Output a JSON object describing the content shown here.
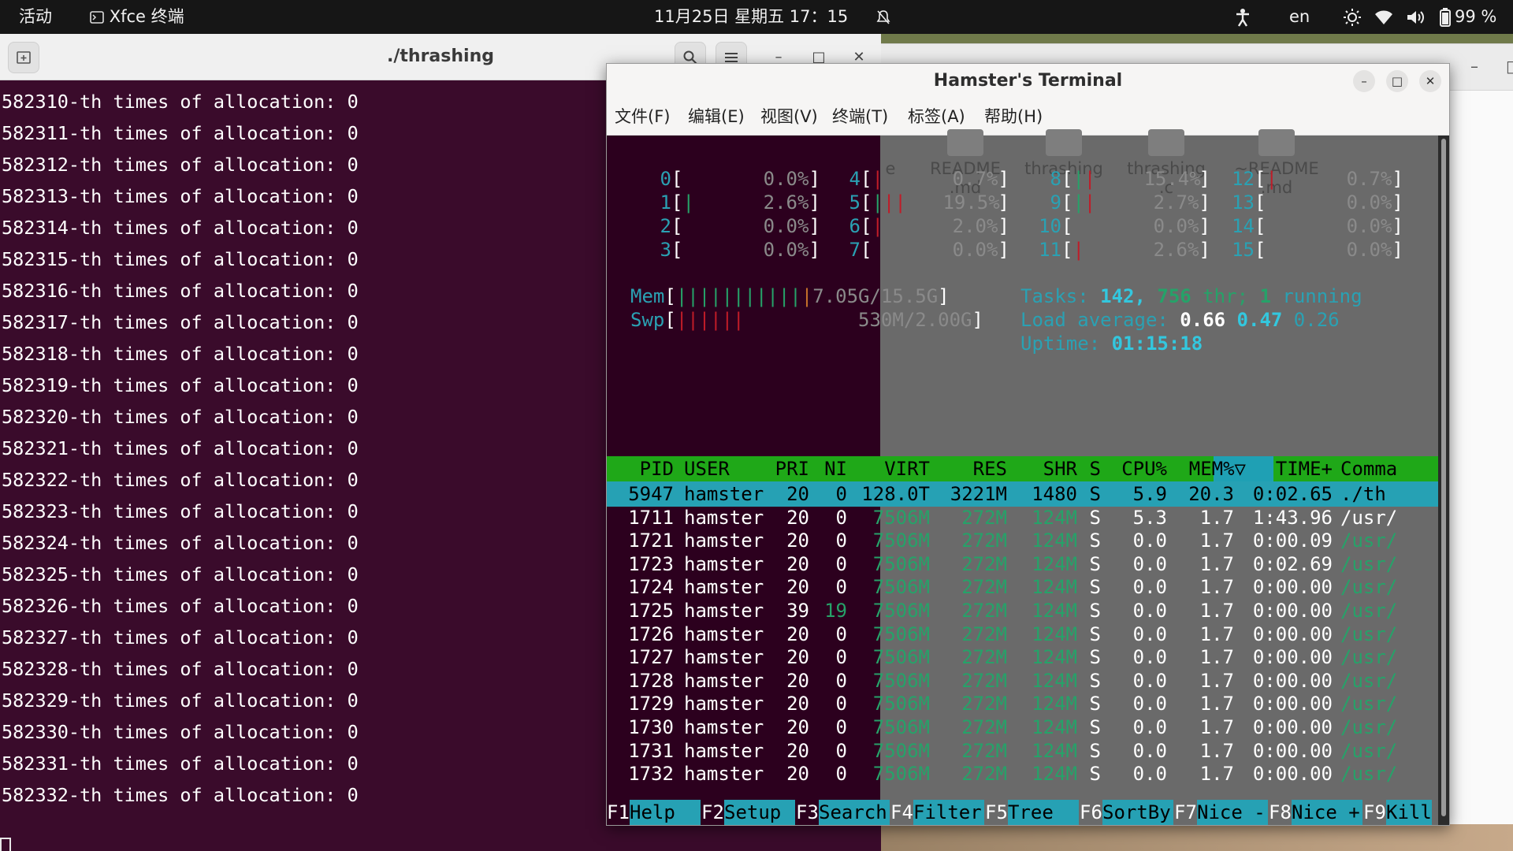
{
  "topbar": {
    "activities": "活动",
    "app_name": "Xfce 终端",
    "datetime": "11月25日 星期五 17：15",
    "lang": "en",
    "battery": "99 %"
  },
  "left_terminal": {
    "title": "./thrashing",
    "lines": [
      "582310-th times of allocation: 0",
      "582311-th times of allocation: 0",
      "582312-th times of allocation: 0",
      "582313-th times of allocation: 0",
      "582314-th times of allocation: 0",
      "582315-th times of allocation: 0",
      "582316-th times of allocation: 0",
      "582317-th times of allocation: 0",
      "582318-th times of allocation: 0",
      "582319-th times of allocation: 0",
      "582320-th times of allocation: 0",
      "582321-th times of allocation: 0",
      "582322-th times of allocation: 0",
      "582323-th times of allocation: 0",
      "582324-th times of allocation: 0",
      "582325-th times of allocation: 0",
      "582326-th times of allocation: 0",
      "582327-th times of allocation: 0",
      "582328-th times of allocation: 0",
      "582329-th times of allocation: 0",
      "582330-th times of allocation: 0",
      "582331-th times of allocation: 0",
      "582332-th times of allocation: 0"
    ]
  },
  "hamster": {
    "title": "Hamster's Terminal",
    "menu": [
      "文件(F)",
      "编辑(E)",
      "视图(V)",
      "终端(T)",
      "标签(A)",
      "帮助(H)"
    ],
    "desktop_icons": [
      "e",
      "README\n.md",
      "thrashing",
      "thrashing\n.c",
      "~README\n.md"
    ],
    "cpus": [
      {
        "id": "0",
        "pct": "0.0%"
      },
      {
        "id": "1",
        "pct": "2.6%"
      },
      {
        "id": "2",
        "pct": "0.0%"
      },
      {
        "id": "3",
        "pct": "0.0%"
      },
      {
        "id": "4",
        "pct": "0.7%"
      },
      {
        "id": "5",
        "pct": "19.5%"
      },
      {
        "id": "6",
        "pct": "2.0%"
      },
      {
        "id": "7",
        "pct": "0.0%"
      },
      {
        "id": "8",
        "pct": "15.4%"
      },
      {
        "id": "9",
        "pct": "2.7%"
      },
      {
        "id": "10",
        "pct": "0.0%"
      },
      {
        "id": "11",
        "pct": "2.6%"
      },
      {
        "id": "12",
        "pct": "0.7%"
      },
      {
        "id": "13",
        "pct": "0.0%"
      },
      {
        "id": "14",
        "pct": "0.0%"
      },
      {
        "id": "15",
        "pct": "0.0%"
      }
    ],
    "mem_label": "Mem",
    "mem_value": "7.05G/15.5G",
    "swp_label": "Swp",
    "swp_value": "530M/2.00G",
    "tasks_label": "Tasks:",
    "tasks_count": "142,",
    "thr_count": "756",
    "thr_label": "thr;",
    "running_count": "1",
    "running_label": "running",
    "load_label": "Load average:",
    "load1": "0.66",
    "load5": "0.47",
    "load15": "0.26",
    "uptime_label": "Uptime:",
    "uptime": "01:15:18",
    "columns": {
      "pid": "PID",
      "user": "USER",
      "pri": "PRI",
      "ni": "NI",
      "virt": "VIRT",
      "res": "RES",
      "shr": "SHR",
      "s": "S",
      "cpu": "CPU%",
      "mem": "MEM%▽",
      "time": "TIME+",
      "cmd": "Comma"
    },
    "processes": [
      {
        "pid": "5947",
        "user": "hamster",
        "pri": "20",
        "ni": "0",
        "virt": "128.0T",
        "res": "3221M",
        "shr": "1480",
        "s": "S",
        "cpu": "5.9",
        "mem": "20.3",
        "time": "0:02.65",
        "cmd": "./th"
      },
      {
        "pid": "1711",
        "user": "hamster",
        "pri": "20",
        "ni": "0",
        "virt": "7506M",
        "res": "272M",
        "shr": "124M",
        "s": "S",
        "cpu": "5.3",
        "mem": "1.7",
        "time": "1:43.96",
        "cmd": "/usr/"
      },
      {
        "pid": "1721",
        "user": "hamster",
        "pri": "20",
        "ni": "0",
        "virt": "7506M",
        "res": "272M",
        "shr": "124M",
        "s": "S",
        "cpu": "0.0",
        "mem": "1.7",
        "time": "0:00.09",
        "cmd": "/usr/"
      },
      {
        "pid": "1723",
        "user": "hamster",
        "pri": "20",
        "ni": "0",
        "virt": "7506M",
        "res": "272M",
        "shr": "124M",
        "s": "S",
        "cpu": "0.0",
        "mem": "1.7",
        "time": "0:02.69",
        "cmd": "/usr/"
      },
      {
        "pid": "1724",
        "user": "hamster",
        "pri": "20",
        "ni": "0",
        "virt": "7506M",
        "res": "272M",
        "shr": "124M",
        "s": "S",
        "cpu": "0.0",
        "mem": "1.7",
        "time": "0:00.00",
        "cmd": "/usr/"
      },
      {
        "pid": "1725",
        "user": "hamster",
        "pri": "39",
        "ni": "19",
        "virt": "7506M",
        "res": "272M",
        "shr": "124M",
        "s": "S",
        "cpu": "0.0",
        "mem": "1.7",
        "time": "0:00.00",
        "cmd": "/usr/"
      },
      {
        "pid": "1726",
        "user": "hamster",
        "pri": "20",
        "ni": "0",
        "virt": "7506M",
        "res": "272M",
        "shr": "124M",
        "s": "S",
        "cpu": "0.0",
        "mem": "1.7",
        "time": "0:00.00",
        "cmd": "/usr/"
      },
      {
        "pid": "1727",
        "user": "hamster",
        "pri": "20",
        "ni": "0",
        "virt": "7506M",
        "res": "272M",
        "shr": "124M",
        "s": "S",
        "cpu": "0.0",
        "mem": "1.7",
        "time": "0:00.00",
        "cmd": "/usr/"
      },
      {
        "pid": "1728",
        "user": "hamster",
        "pri": "20",
        "ni": "0",
        "virt": "7506M",
        "res": "272M",
        "shr": "124M",
        "s": "S",
        "cpu": "0.0",
        "mem": "1.7",
        "time": "0:00.00",
        "cmd": "/usr/"
      },
      {
        "pid": "1729",
        "user": "hamster",
        "pri": "20",
        "ni": "0",
        "virt": "7506M",
        "res": "272M",
        "shr": "124M",
        "s": "S",
        "cpu": "0.0",
        "mem": "1.7",
        "time": "0:00.00",
        "cmd": "/usr/"
      },
      {
        "pid": "1730",
        "user": "hamster",
        "pri": "20",
        "ni": "0",
        "virt": "7506M",
        "res": "272M",
        "shr": "124M",
        "s": "S",
        "cpu": "0.0",
        "mem": "1.7",
        "time": "0:00.00",
        "cmd": "/usr/"
      },
      {
        "pid": "1731",
        "user": "hamster",
        "pri": "20",
        "ni": "0",
        "virt": "7506M",
        "res": "272M",
        "shr": "124M",
        "s": "S",
        "cpu": "0.0",
        "mem": "1.7",
        "time": "0:00.00",
        "cmd": "/usr/"
      },
      {
        "pid": "1732",
        "user": "hamster",
        "pri": "20",
        "ni": "0",
        "virt": "7506M",
        "res": "272M",
        "shr": "124M",
        "s": "S",
        "cpu": "0.0",
        "mem": "1.7",
        "time": "0:00.00",
        "cmd": "/usr/"
      }
    ],
    "fkeys": [
      {
        "num": "F1",
        "label": "Help"
      },
      {
        "num": "F2",
        "label": "Setup"
      },
      {
        "num": "F3",
        "label": "Search"
      },
      {
        "num": "F4",
        "label": "Filter"
      },
      {
        "num": "F5",
        "label": "Tree"
      },
      {
        "num": "F6",
        "label": "SortBy"
      },
      {
        "num": "F7",
        "label": "Nice -"
      },
      {
        "num": "F8",
        "label": "Nice +"
      },
      {
        "num": "F9",
        "label": "Kill"
      }
    ]
  }
}
